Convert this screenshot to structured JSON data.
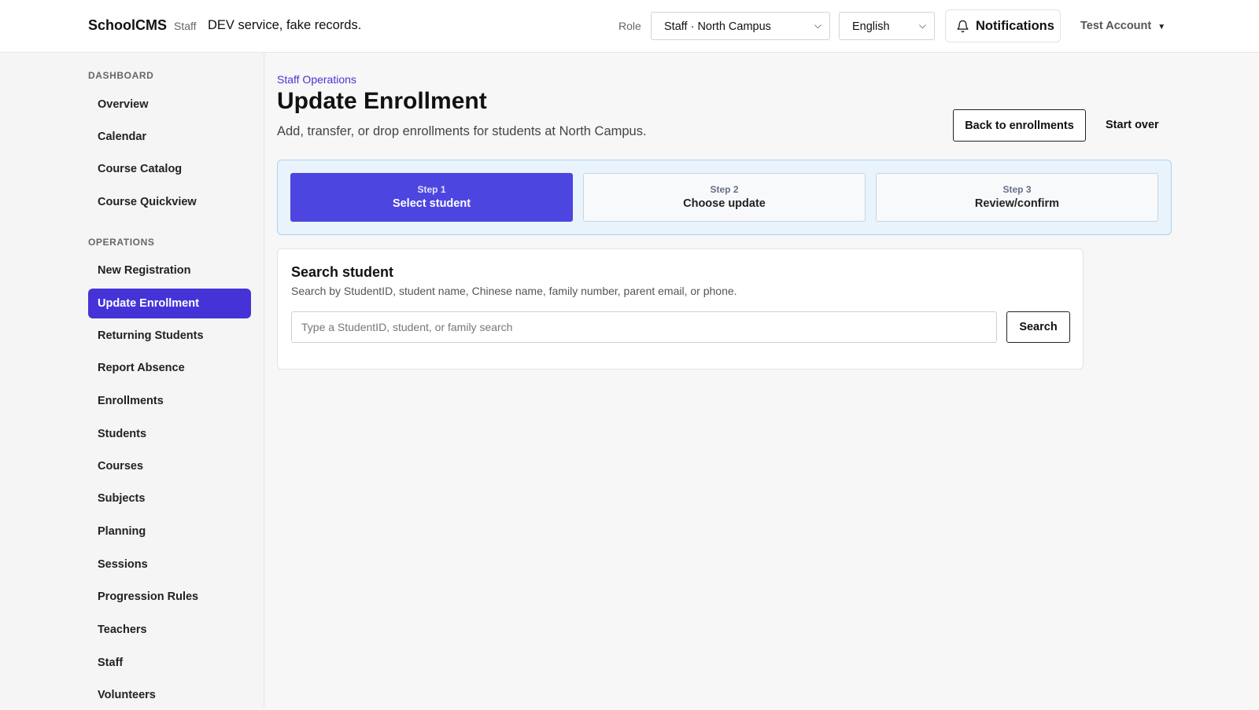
{
  "header": {
    "brand": "SchoolCMS",
    "role_tag": "Staff",
    "environment_note": "DEV service, fake records.",
    "role_label": "Role",
    "role_select": "Staff · North Campus",
    "language_select": "English",
    "notifications": "Notifications",
    "account": "Test Account"
  },
  "sidebar": {
    "dashboard_title": "DASHBOARD",
    "dashboard_items": [
      {
        "label": "Overview"
      },
      {
        "label": "Calendar"
      },
      {
        "label": "Course Catalog"
      },
      {
        "label": "Course Quickview"
      }
    ],
    "operations_title": "OPERATIONS",
    "operations_items": [
      {
        "label": "New Registration"
      },
      {
        "label": "Update Enrollment",
        "active": true
      },
      {
        "label": "Returning Students"
      },
      {
        "label": "Report Absence"
      },
      {
        "label": "Enrollments"
      },
      {
        "label": "Students"
      },
      {
        "label": "Courses"
      },
      {
        "label": "Subjects"
      },
      {
        "label": "Planning"
      },
      {
        "label": "Sessions"
      },
      {
        "label": "Progression Rules"
      },
      {
        "label": "Teachers"
      },
      {
        "label": "Staff"
      },
      {
        "label": "Volunteers"
      }
    ]
  },
  "main": {
    "breadcrumb": "Staff Operations",
    "title": "Update Enrollment",
    "subtitle": "Add, transfer, or drop enrollments for students at North Campus.",
    "back_button": "Back to enrollments",
    "start_over_button": "Start over",
    "steps": [
      {
        "number": "Step 1",
        "label": "Select student",
        "active": true
      },
      {
        "number": "Step 2",
        "label": "Choose update"
      },
      {
        "number": "Step 3",
        "label": "Review/confirm"
      }
    ],
    "search_card": {
      "title": "Search student",
      "help": "Search by StudentID, student name, Chinese name, family number, parent email, or phone.",
      "input_value": "",
      "placeholder": "Type a StudentID, student, or family search",
      "button": "Search"
    }
  },
  "icons": {
    "notifications": "bell-icon",
    "select_chevron": "chevron-down-icon",
    "account_menu": "caret-down-icon"
  },
  "colors": {
    "accent": "#4633d8",
    "step_active": "#4d45e0",
    "stepper_background": "#e9f3fb",
    "stepper_border": "#a9d3f1",
    "link": "#4a33d6"
  }
}
